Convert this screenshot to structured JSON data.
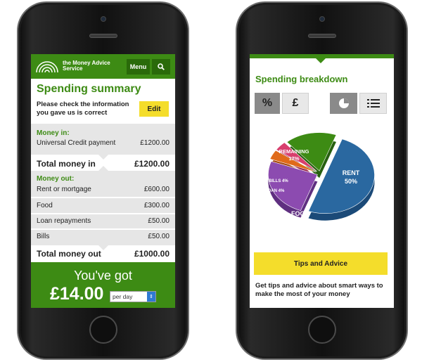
{
  "left": {
    "logo_text": "the Money Advice Service",
    "menu_label": "Menu",
    "title": "Spending summary",
    "check_text": "Please check the information you gave us is correct",
    "edit_label": "Edit",
    "money_in_heading": "Money in:",
    "money_in_rows": [
      {
        "label": "Universal Credit payment",
        "value": "£1200.00"
      }
    ],
    "total_in": {
      "label": "Total money in",
      "value": "£1200.00"
    },
    "money_out_heading": "Money out:",
    "money_out_rows": [
      {
        "label": "Rent or mortgage",
        "value": "£600.00"
      },
      {
        "label": "Food",
        "value": "£300.00"
      },
      {
        "label": "Loan repayments",
        "value": "£50.00"
      },
      {
        "label": "Bills",
        "value": "£50.00"
      }
    ],
    "total_out": {
      "label": "Total money out",
      "value": "£1000.00"
    },
    "got_label": "You've got",
    "amount": "£14.00",
    "period_selected": "per day"
  },
  "right": {
    "title": "Spending breakdown",
    "toggle_percent": "%",
    "toggle_pound": "£",
    "tips_label": "Tips and Advice",
    "tips_text": "Get tips and advice about smart ways to make the most of your money",
    "colors": {
      "green": "#3d8b14",
      "yellow": "#f4dd2b",
      "rent": "#2a68a0",
      "food": "#8c4bb0",
      "loan": "#e06a1a",
      "bills": "#d8406e",
      "remaining": "#3d8b14"
    }
  },
  "chart_data": {
    "type": "pie",
    "slices": [
      {
        "label": "RENT",
        "value": 50,
        "display": "50%"
      },
      {
        "label": "FOOD",
        "value": 25,
        "display": "25%"
      },
      {
        "label": "LOAN",
        "value": 4,
        "display": "4%"
      },
      {
        "label": "BILLS",
        "value": 4,
        "display": "4%"
      },
      {
        "label": "REMAINING",
        "value": 17,
        "display": "17%"
      }
    ]
  }
}
